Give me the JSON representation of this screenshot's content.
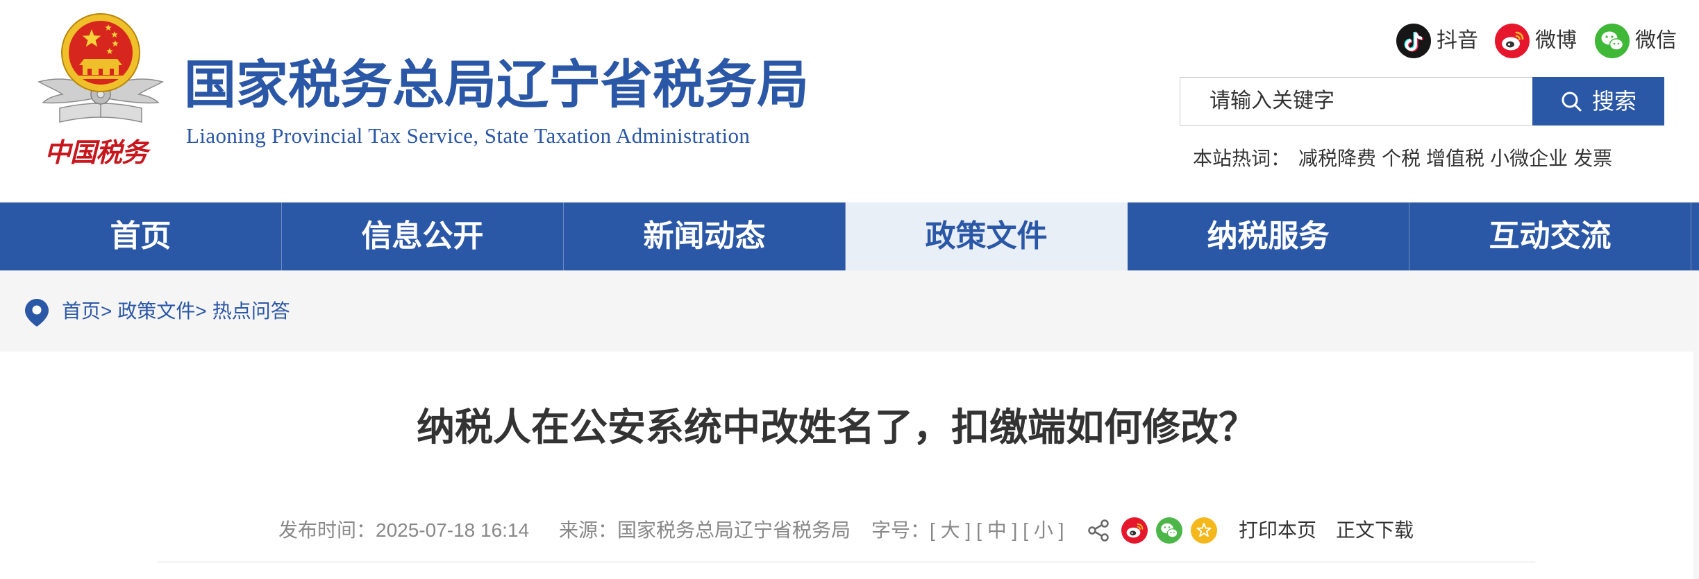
{
  "header": {
    "logo_text": "中国税务",
    "emblem_icon": "national-emblem-icon",
    "title": "国家税务总局辽宁省税务局",
    "subtitle": "Liaoning Provincial Tax Service, State Taxation Administration",
    "social": [
      {
        "label": "抖音",
        "icon": "douyin-icon"
      },
      {
        "label": "微博",
        "icon": "weibo-icon"
      },
      {
        "label": "微信",
        "icon": "wechat-icon"
      }
    ],
    "search": {
      "placeholder": "请输入关键字",
      "button_label": "搜索",
      "icon": "search-icon"
    },
    "hot_words": {
      "label": "本站热词：",
      "items": [
        "减税降费",
        "个税",
        "增值税",
        "小微企业",
        "发票"
      ]
    }
  },
  "nav": {
    "items": [
      {
        "label": "首页",
        "active": false
      },
      {
        "label": "信息公开",
        "active": false
      },
      {
        "label": "新闻动态",
        "active": false
      },
      {
        "label": "政策文件",
        "active": true
      },
      {
        "label": "纳税服务",
        "active": false
      },
      {
        "label": "互动交流",
        "active": false
      }
    ]
  },
  "breadcrumb": {
    "icon": "location-pin-icon",
    "separator": ">",
    "items": [
      "首页",
      "政策文件",
      "热点问答"
    ]
  },
  "article": {
    "title": "纳税人在公安系统中改姓名了，扣缴端如何修改？",
    "meta": {
      "publish_label": "发布时间：",
      "publish_time": "2025-07-18 16:14",
      "source_label": "来源：",
      "source": "国家税务总局辽宁省税务局",
      "font_size_label": "字号：",
      "font_sizes": [
        "[ 大 ]",
        "[ 中 ]",
        "[ 小 ]"
      ],
      "share_icons": [
        "share-icon",
        "weibo-icon",
        "wechat-icon",
        "favorite-icon"
      ],
      "print_label": "打印本页",
      "download_label": "正文下载"
    }
  },
  "colors": {
    "brand_blue": "#2b57a7",
    "nav_active_bg": "#e9eff7",
    "logo_red": "#c8161d",
    "weibo_red": "#e6162d",
    "wechat_green": "#3fb837",
    "favorite_yellow": "#f5b81c",
    "douyin_black": "#161616"
  }
}
